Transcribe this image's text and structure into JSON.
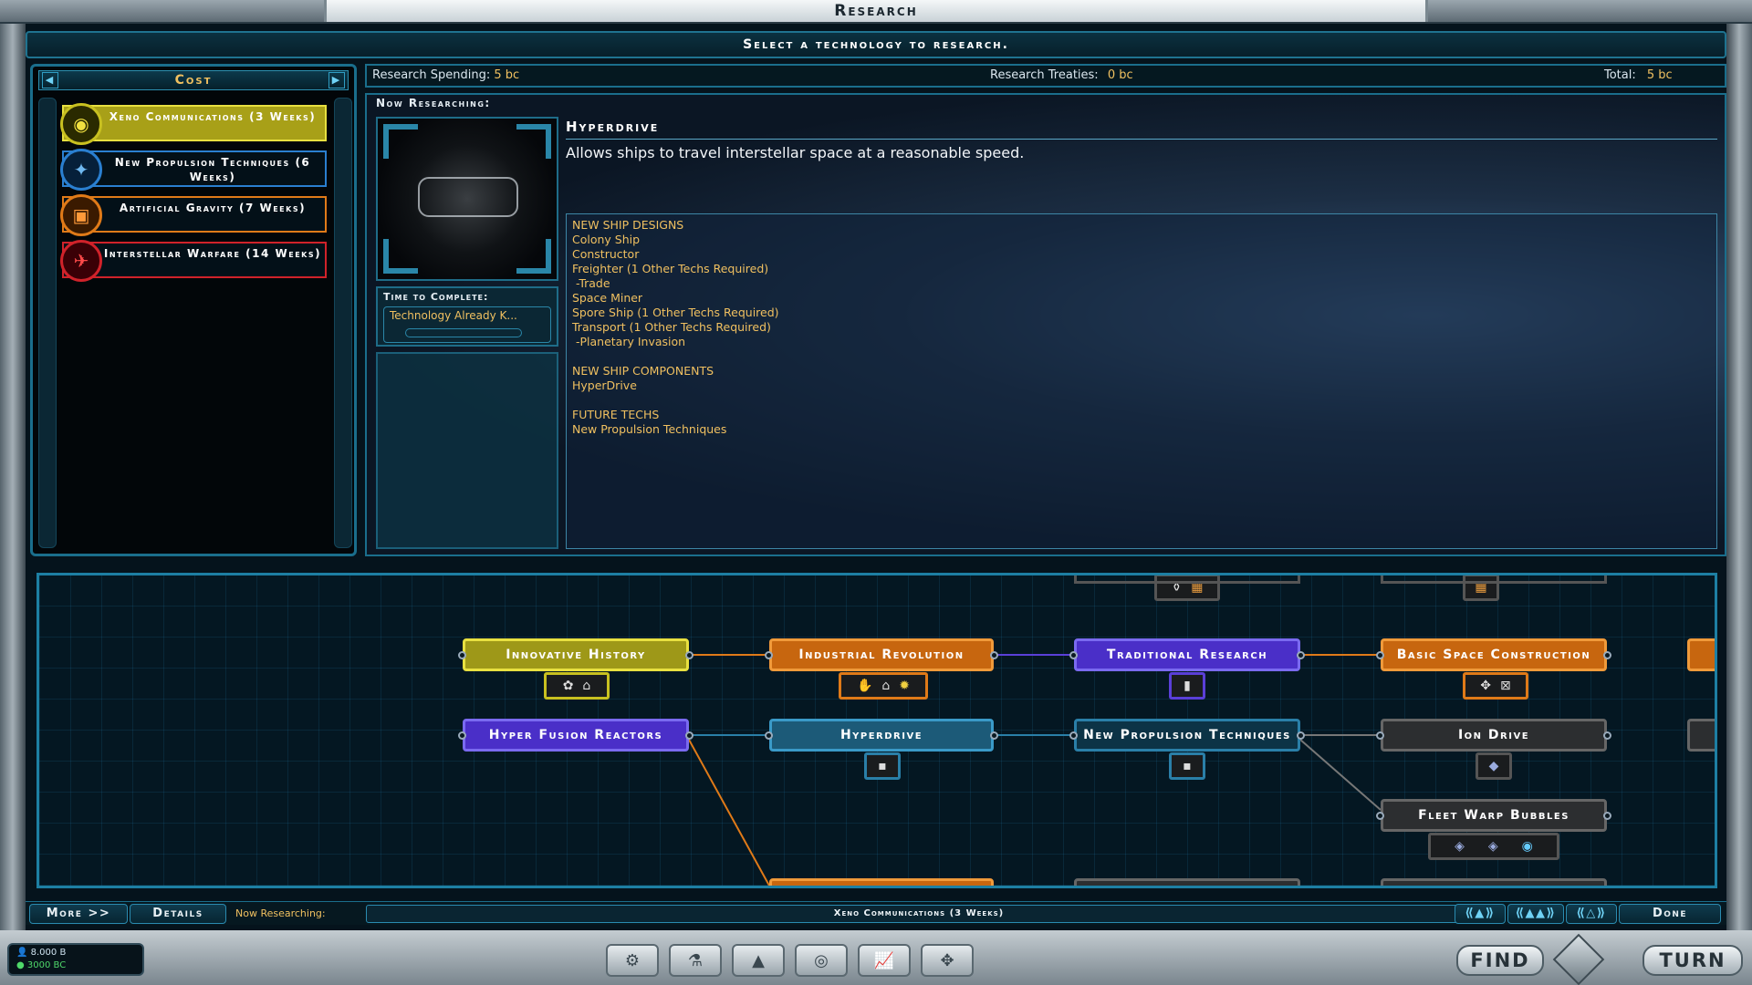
{
  "window": {
    "title": "Research"
  },
  "subtitle": "Select a technology to research.",
  "cost_panel": {
    "header": "Cost",
    "prev_icon": "left-arrow",
    "next_icon": "right-arrow",
    "queue": [
      {
        "label": "Xeno Communications (3 Weeks)",
        "icon": "speech-bubble-icon",
        "color": "#c8c020",
        "selected": true
      },
      {
        "label": "New Propulsion Techniques (6 Weeks)",
        "icon": "propulsion-icon",
        "color": "#2a7fd0"
      },
      {
        "label": "Artificial Gravity (7 Weeks)",
        "icon": "gravity-icon",
        "color": "#e07a18"
      },
      {
        "label": "Interstellar Warfare (14 Weeks)",
        "icon": "warship-icon",
        "color": "#d0222a"
      }
    ]
  },
  "spending": {
    "research_spending_label": "Research Spending:",
    "research_spending_value": "5 bc",
    "treaties_label": "Research Treaties:",
    "treaties_value": "0 bc",
    "total_label": "Total:",
    "total_value": "5 bc"
  },
  "research": {
    "now_label": "Now Researching:",
    "tech_name": "Hyperdrive",
    "tech_description": "Allows ships to travel interstellar space at a reasonable speed.",
    "time_label": "Time to Complete:",
    "time_value": "Technology Already K...",
    "details": [
      "NEW SHIP DESIGNS",
      "Colony Ship",
      "Constructor",
      "Freighter (1 Other Techs Required)",
      " -Trade",
      "Space Miner",
      "Spore Ship (1 Other Techs Required)",
      "Transport (1 Other Techs Required)",
      " -Planetary Invasion",
      "",
      "NEW SHIP COMPONENTS",
      "HyperDrive",
      "",
      "FUTURE TECHS",
      "New Propulsion Techniques"
    ]
  },
  "tree": {
    "nodes": [
      {
        "label": "Innovative History",
        "color": "#c8c020"
      },
      {
        "label": "Industrial Revolution",
        "color": "#e07a18"
      },
      {
        "label": "Traditional Research",
        "color": "#5a3fd8"
      },
      {
        "label": "Basic Space Construction",
        "color": "#e07a18"
      },
      {
        "label": "Hyper Fusion Reactors",
        "color": "#5a3fd8"
      },
      {
        "label": "Hyperdrive",
        "color": "#2a7fa8"
      },
      {
        "label": "New Propulsion Techniques",
        "color": "#2a7fa8"
      },
      {
        "label": "Ion Drive",
        "color": "#555555"
      },
      {
        "label": "Fleet Warp Bubbles",
        "color": "#555555"
      }
    ]
  },
  "bottom_bar": {
    "more": "More >>",
    "details": "Details",
    "now_researching_label": "Now Researching:",
    "now_researching_value": "Xeno Communications (3 Weeks)",
    "done": "Done"
  },
  "footer": {
    "population": "8.000 B",
    "credits": "3000 BC",
    "find": "FIND",
    "turn": "TURN"
  }
}
